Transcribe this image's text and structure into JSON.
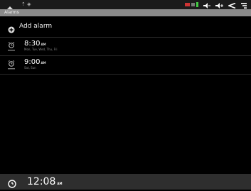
{
  "app": {
    "title": "Alarms"
  },
  "status_bar": {
    "icons": [
      "home-icon",
      "notification-icon",
      "signal-icon",
      "battery-icon",
      "volume-down-icon",
      "volume-up-icon",
      "back-icon",
      "menu-icon"
    ]
  },
  "list": {
    "add_alarm_label": "Add alarm",
    "alarms": [
      {
        "time": "8:30",
        "ampm": "AM",
        "days": "Mon, Tue, Wed, Thu, Fri",
        "enabled": false
      },
      {
        "time": "9:00",
        "ampm": "AM",
        "days": "Sat, Sun",
        "enabled": false
      }
    ]
  },
  "clock": {
    "time": "12:08",
    "ampm": "AM"
  },
  "colors": {
    "background": "#000000",
    "status_bar": "#1b1b1b",
    "title_strip": "#8a8a8a",
    "bottom_bar": "#2e2e2e"
  }
}
